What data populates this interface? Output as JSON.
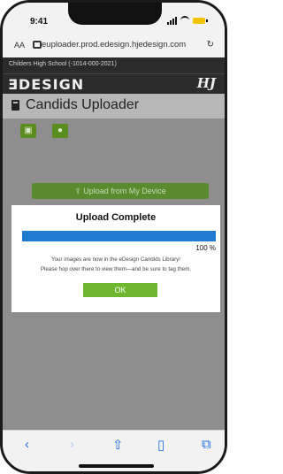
{
  "status": {
    "time": "9:41"
  },
  "browser": {
    "aa_label": "AA",
    "url": "euploader.prod.edesign.hjedesign.com"
  },
  "site": {
    "school": "Childers High School (-1014-000-2021)",
    "logo_text": "ƎDESIGN",
    "page_title": "Candids Uploader",
    "upload_button_label": "Upload from My Device"
  },
  "modal": {
    "title": "Upload Complete",
    "progress": 1.0,
    "progress_label": "100 %",
    "message_line1": "Your images are now in the eDesign Candids Library!",
    "message_line2": "Please hop over there to view them—and be sure to tag them.",
    "ok_label": "OK"
  },
  "colors": {
    "accent_green": "#6fb72e",
    "progress_blue": "#1f7bd0",
    "ios_blue": "#1f6fe0"
  },
  "icons": [
    "search-icon",
    "lock-icon",
    "reload-icon",
    "document-icon",
    "user-icon",
    "upload-icon",
    "back-icon",
    "forward-icon",
    "share-icon",
    "bookmarks-icon",
    "tabs-icon"
  ]
}
